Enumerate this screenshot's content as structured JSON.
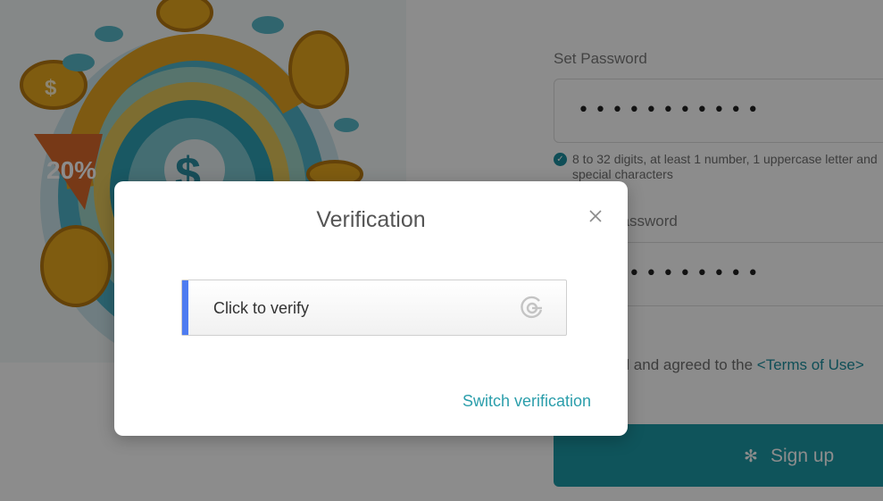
{
  "hero": {
    "badge": "20%",
    "coin_symbol": "$"
  },
  "form": {
    "set_password_label": "Set Password",
    "password_value": "•••••••••••",
    "hint_text": "8 to 32 digits, at least 1 number, 1 uppercase letter and special characters",
    "confirm_password_label": "Confirm Password",
    "confirm_password_value": "•••••••••••",
    "agree_text": "I have read and agreed to the ",
    "terms_link": "<Terms of Use>",
    "signup_label": "Sign up"
  },
  "modal": {
    "title": "Verification",
    "verify_label": "Click to verify",
    "switch_label": "Switch verification"
  },
  "colors": {
    "accent": "#1d9aa7",
    "link": "#2b9eab",
    "verify_bar": "#4e7cf1"
  }
}
